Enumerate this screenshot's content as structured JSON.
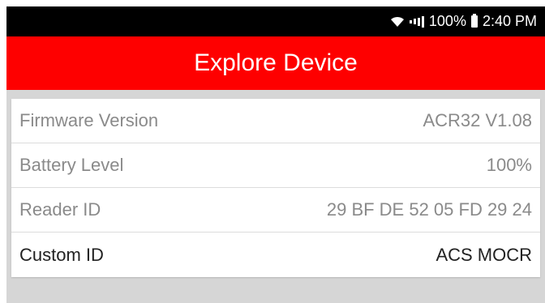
{
  "status_bar": {
    "battery_percent": "100%",
    "time": "2:40 PM",
    "icons": [
      "wifi-icon",
      "signal-icon",
      "battery-icon"
    ]
  },
  "app_bar": {
    "title": "Explore Device",
    "color": "#fe0000"
  },
  "device_info": [
    {
      "label": "Firmware Version",
      "value": "ACR32 V1.08",
      "editable": false
    },
    {
      "label": "Battery Level",
      "value": "100%",
      "editable": false
    },
    {
      "label": "Reader ID",
      "value": "29 BF DE 52 05 FD 29 24",
      "editable": false
    },
    {
      "label": "Custom ID",
      "value": "ACS MOCR",
      "editable": true
    }
  ]
}
